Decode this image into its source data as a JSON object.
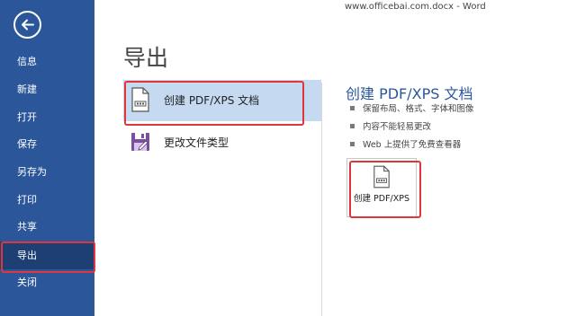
{
  "window": {
    "title": "www.officebai.com.docx - Word"
  },
  "sidebar": {
    "items": [
      {
        "label": "信息"
      },
      {
        "label": "新建"
      },
      {
        "label": "打开"
      },
      {
        "label": "保存"
      },
      {
        "label": "另存为"
      },
      {
        "label": "打印"
      },
      {
        "label": "共享"
      },
      {
        "label": "导出"
      },
      {
        "label": "关闭"
      }
    ],
    "active_item": "导出"
  },
  "main": {
    "title": "导出",
    "options": [
      {
        "label": "创建 PDF/XPS 文档",
        "icon": "pdf-document-icon",
        "selected": true
      },
      {
        "label": "更改文件类型",
        "icon": "change-file-type-icon",
        "selected": false
      }
    ]
  },
  "detail": {
    "title": "创建 PDF/XPS 文档",
    "bullets": [
      "保留布局、格式、字体和图像",
      "内容不能轻易更改",
      "Web 上提供了免费查看器"
    ],
    "button_label": "创建 PDF/XPS",
    "button_icon": "pdf-document-icon"
  },
  "colors": {
    "sidebar_bg": "#2b579a",
    "sidebar_active_bg": "#1e3f73",
    "selected_option_bg": "#c5d9f1",
    "highlight_border": "#e0353a",
    "accent_text": "#2b579a"
  }
}
